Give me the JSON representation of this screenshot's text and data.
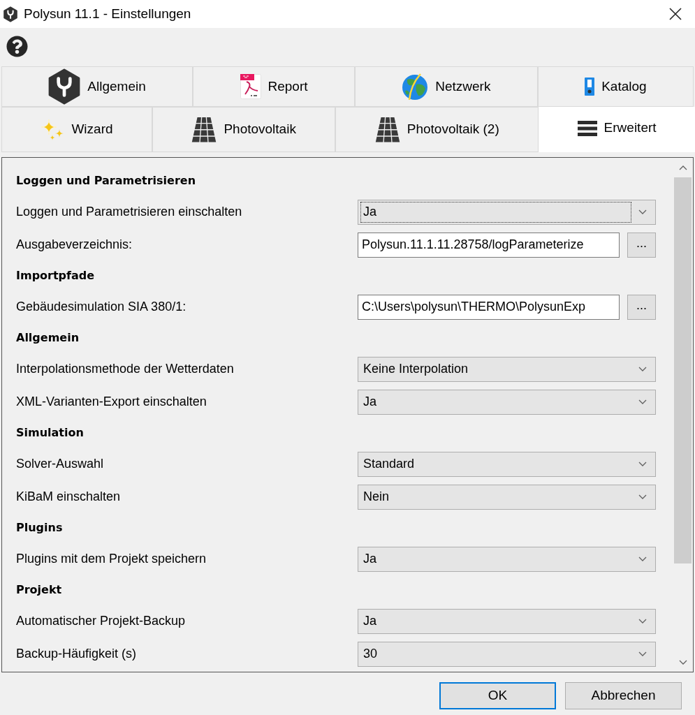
{
  "window": {
    "title": "Polysun 11.1 - Einstellungen"
  },
  "tab_rows": [
    {
      "tabs": [
        {
          "label": "Allgemein",
          "selected": false
        },
        {
          "label": "Report",
          "selected": false
        },
        {
          "label": "Netzwerk",
          "selected": false
        },
        {
          "label": "Katalog",
          "selected": false
        }
      ]
    },
    {
      "tabs": [
        {
          "label": "Wizard",
          "selected": false
        },
        {
          "label": "Photovoltaik",
          "selected": false
        },
        {
          "label": "Photovoltaik (2)",
          "selected": false
        },
        {
          "label": "Erweitert",
          "selected": true
        }
      ]
    }
  ],
  "settings": [
    {
      "kind": "heading",
      "label": "Loggen und Parametrisieren"
    },
    {
      "kind": "combo",
      "label": "Loggen und Parametrisieren einschalten",
      "value": "Ja",
      "focused": true
    },
    {
      "kind": "path",
      "label": "Ausgabeverzeichnis:",
      "value": "Polysun.11.1.11.28758/logParameterize",
      "button": "..."
    },
    {
      "kind": "heading",
      "label": "Importpfade"
    },
    {
      "kind": "path",
      "label": "Gebäudesimulation SIA 380/1:",
      "value": "C:\\Users\\polysun\\THERMO\\PolysunExp",
      "button": "..."
    },
    {
      "kind": "heading",
      "label": "Allgemein"
    },
    {
      "kind": "combo",
      "label": "Interpolationsmethode der Wetterdaten",
      "value": "Keine Interpolation",
      "focused": false
    },
    {
      "kind": "combo",
      "label": "XML-Varianten-Export einschalten",
      "value": "Ja",
      "focused": false
    },
    {
      "kind": "heading",
      "label": "Simulation"
    },
    {
      "kind": "combo",
      "label": "Solver-Auswahl",
      "value": "Standard",
      "focused": false
    },
    {
      "kind": "combo",
      "label": "KiBaM einschalten",
      "value": "Nein",
      "focused": false
    },
    {
      "kind": "heading",
      "label": "Plugins"
    },
    {
      "kind": "combo",
      "label": "Plugins mit dem Projekt speichern",
      "value": "Ja",
      "focused": false
    },
    {
      "kind": "heading",
      "label": "Projekt"
    },
    {
      "kind": "combo",
      "label": "Automatischer Projekt-Backup",
      "value": "Ja",
      "focused": false
    },
    {
      "kind": "combo",
      "label": "Backup-Häufigkeit (s)",
      "value": "30",
      "focused": false
    }
  ],
  "buttons": [
    {
      "label": "OK",
      "default": true
    },
    {
      "label": "Abbrechen",
      "default": false
    }
  ]
}
